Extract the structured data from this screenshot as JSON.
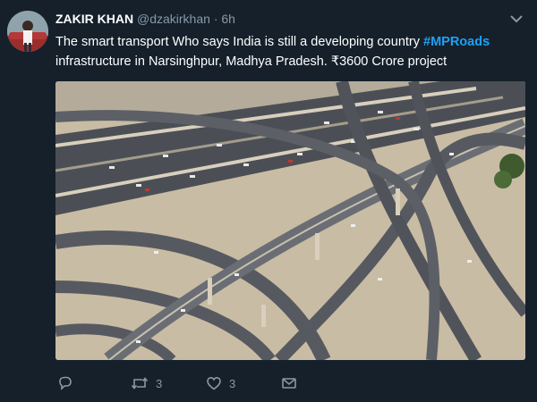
{
  "tweet": {
    "author_name": "ZAKIR KHAN",
    "handle": "@dzakirkhan",
    "separator": "·",
    "time": "6h",
    "text_before": "The smart transport Who says India is still a developing country ",
    "hashtag": "#MPRoads",
    "text_after": " infrastructure in Narsinghpur, Madhya Pradesh. ₹3600 Crore project",
    "media_alt": "aerial photo of multi-level highway interchange"
  },
  "actions": {
    "reply_count": "",
    "retweet_count": "3",
    "like_count": "3"
  },
  "colors": {
    "background": "#15202b",
    "hashtag": "#1da1f2",
    "muted": "#8899a6"
  },
  "icons": [
    "caret-down-icon",
    "reply-icon",
    "retweet-icon",
    "like-icon",
    "message-icon"
  ]
}
